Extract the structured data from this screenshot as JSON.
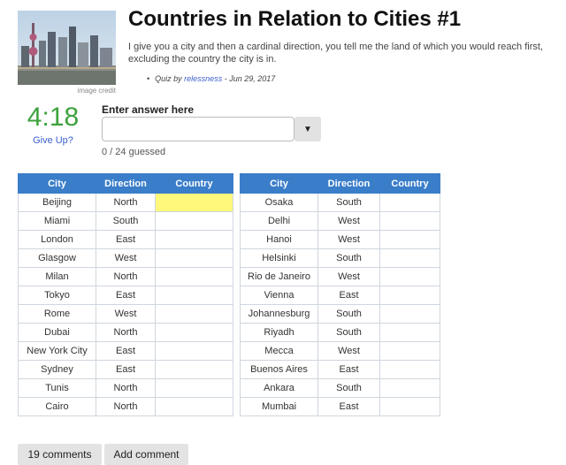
{
  "quiz": {
    "title": "Countries in Relation to Cities #1",
    "description": "I give you a city and then a cardinal direction, you tell me the land of which you would reach first, excluding the country the city is in.",
    "image_credit": "image credit",
    "meta_prefix": "Quiz by ",
    "author": "relessness",
    "meta_date": " - Jun 29, 2017"
  },
  "timer": {
    "value": "4:18",
    "give_up_label": "Give Up?"
  },
  "answer": {
    "label": "Enter answer here",
    "value": "",
    "placeholder": "",
    "progress": "0 / 24 guessed"
  },
  "table_headers": [
    "City",
    "Direction",
    "Country"
  ],
  "table_left": [
    [
      "Beijing",
      "North",
      ""
    ],
    [
      "Miami",
      "South",
      ""
    ],
    [
      "London",
      "East",
      ""
    ],
    [
      "Glasgow",
      "West",
      ""
    ],
    [
      "Milan",
      "North",
      ""
    ],
    [
      "Tokyo",
      "East",
      ""
    ],
    [
      "Rome",
      "West",
      ""
    ],
    [
      "Dubai",
      "North",
      ""
    ],
    [
      "New York City",
      "East",
      ""
    ],
    [
      "Sydney",
      "East",
      ""
    ],
    [
      "Tunis",
      "North",
      ""
    ],
    [
      "Cairo",
      "North",
      ""
    ]
  ],
  "table_right": [
    [
      "Osaka",
      "South",
      ""
    ],
    [
      "Delhi",
      "West",
      ""
    ],
    [
      "Hanoi",
      "West",
      ""
    ],
    [
      "Helsinki",
      "South",
      ""
    ],
    [
      "Rio de Janeiro",
      "West",
      ""
    ],
    [
      "Vienna",
      "East",
      ""
    ],
    [
      "Johannesburg",
      "South",
      ""
    ],
    [
      "Riyadh",
      "South",
      ""
    ],
    [
      "Mecca",
      "West",
      ""
    ],
    [
      "Buenos Aires",
      "East",
      ""
    ],
    [
      "Ankara",
      "South",
      ""
    ],
    [
      "Mumbai",
      "East",
      ""
    ]
  ],
  "buttons": {
    "comments": "19 comments",
    "add_comment": "Add comment"
  },
  "colors": {
    "header_blue": "#3a7dc9",
    "timer_green": "#3ca23c",
    "highlight_yellow": "#fff87a",
    "link_blue": "#3a5ecc"
  }
}
